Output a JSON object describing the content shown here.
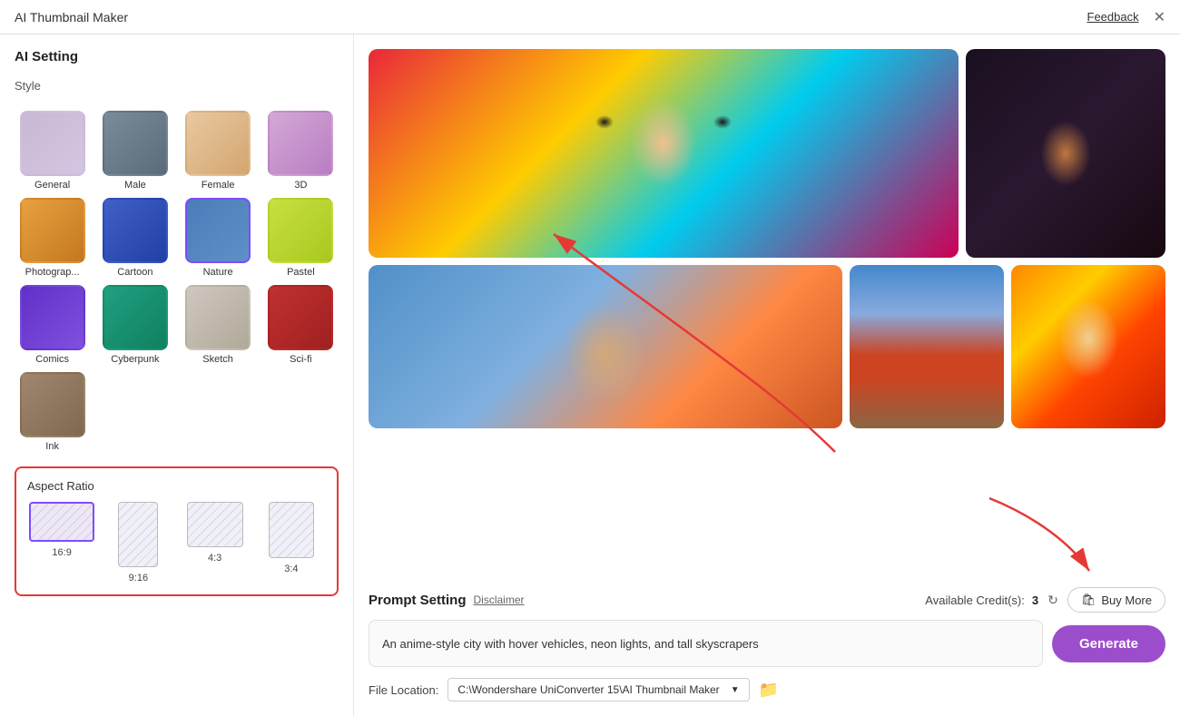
{
  "app": {
    "title": "AI Thumbnail Maker",
    "feedback_label": "Feedback",
    "close_label": "✕"
  },
  "left_panel": {
    "title": "AI Setting",
    "style_section_label": "Style",
    "styles": [
      {
        "id": "general",
        "label": "General",
        "thumb_class": "thumb-general",
        "selected": false
      },
      {
        "id": "male",
        "label": "Male",
        "thumb_class": "thumb-male",
        "selected": false
      },
      {
        "id": "female",
        "label": "Female",
        "thumb_class": "thumb-female",
        "selected": false
      },
      {
        "id": "3d",
        "label": "3D",
        "thumb_class": "thumb-3d",
        "selected": false
      },
      {
        "id": "photography",
        "label": "Photograp...",
        "thumb_class": "thumb-photo",
        "selected": false
      },
      {
        "id": "cartoon",
        "label": "Cartoon",
        "thumb_class": "thumb-cartoon",
        "selected": false
      },
      {
        "id": "nature",
        "label": "Nature",
        "thumb_class": "thumb-nature",
        "selected": true
      },
      {
        "id": "pastel",
        "label": "Pastel",
        "thumb_class": "thumb-pastel",
        "selected": false
      },
      {
        "id": "comics",
        "label": "Comics",
        "thumb_class": "thumb-comics",
        "selected": false
      },
      {
        "id": "cyberpunk",
        "label": "Cyberpunk",
        "thumb_class": "thumb-cyberpunk",
        "selected": false
      },
      {
        "id": "sketch",
        "label": "Sketch",
        "thumb_class": "thumb-sketch",
        "selected": false
      },
      {
        "id": "scifi",
        "label": "Sci-fi",
        "thumb_class": "thumb-scifi",
        "selected": false
      },
      {
        "id": "ink",
        "label": "Ink",
        "thumb_class": "thumb-ink",
        "selected": false
      }
    ],
    "aspect_ratio_label": "Aspect Ratio",
    "aspect_ratios": [
      {
        "id": "16-9",
        "label": "16:9",
        "selected": true,
        "box_class": "aspect-16-9"
      },
      {
        "id": "9-16",
        "label": "9:16",
        "selected": false,
        "box_class": "aspect-9-16"
      },
      {
        "id": "4-3",
        "label": "4:3",
        "selected": false,
        "box_class": "aspect-4-3"
      },
      {
        "id": "3-4",
        "label": "3:4",
        "selected": false,
        "box_class": "aspect-3-4"
      }
    ]
  },
  "right_panel": {
    "prompt_section": {
      "title": "Prompt Setting",
      "disclaimer_label": "Disclaimer",
      "credits_label": "Available Credit(s):",
      "credits_count": "3",
      "buy_more_label": "Buy More",
      "prompt_text": "An anime-style city with hover vehicles, neon lights, and tall skyscrapers",
      "generate_label": "Generate"
    },
    "file_location": {
      "label": "File Location:",
      "path": "C:\\Wondershare UniConverter 15\\AI Thumbnail Maker",
      "dropdown_arrow": "▼"
    }
  }
}
